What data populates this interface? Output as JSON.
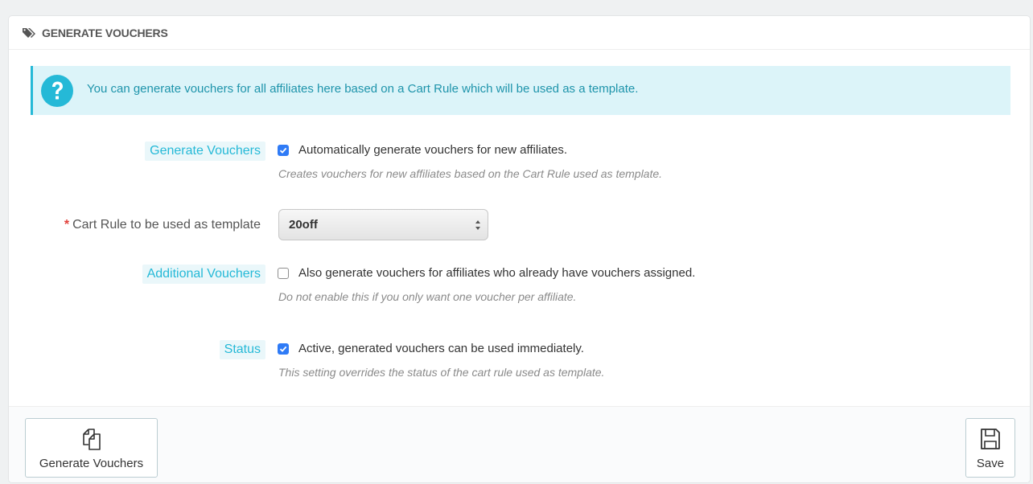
{
  "panel": {
    "title": "GENERATE VOUCHERS",
    "title_icon": "tags-icon"
  },
  "alert": {
    "icon": "question-circle-icon",
    "text": "You can generate vouchers for all affiliates here based on a Cart Rule which will be used as a template."
  },
  "form": {
    "generate_vouchers": {
      "label": "Generate Vouchers",
      "checked": true,
      "checkbox_label": "Automatically generate vouchers for new affiliates.",
      "help": "Creates vouchers for new affiliates based on the Cart Rule used as template."
    },
    "cart_rule": {
      "required_mark": "*",
      "label": "Cart Rule to be used as template",
      "selected": "20off"
    },
    "additional_vouchers": {
      "label": "Additional Vouchers",
      "checked": false,
      "checkbox_label": "Also generate vouchers for affiliates who already have vouchers assigned.",
      "help": "Do not enable this if you only want one voucher per affiliate."
    },
    "status": {
      "label": "Status",
      "checked": true,
      "checkbox_label": "Active, generated vouchers can be used immediately.",
      "help": "This setting overrides the status of the cart rule used as template."
    }
  },
  "footer": {
    "generate_button": {
      "label": "Generate Vouchers",
      "icon": "copy-icon"
    },
    "save_button": {
      "label": "Save",
      "icon": "floppy-disk-icon"
    }
  },
  "colors": {
    "accent": "#25b9d7",
    "alert_bg": "#dcf4f9",
    "checkbox_checked": "#2f7bf6",
    "required": "#e1413b"
  }
}
